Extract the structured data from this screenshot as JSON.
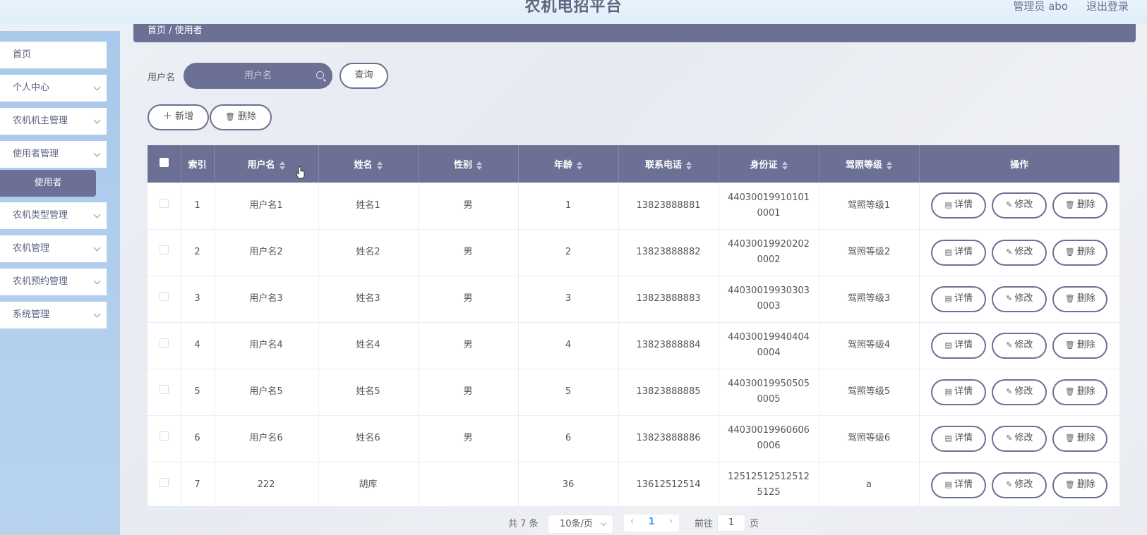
{
  "header": {
    "title": "农机电招平台",
    "user": "管理员 abo",
    "logout": "退出登录"
  },
  "sidebar": {
    "items": [
      {
        "label": "首页",
        "expandable": false
      },
      {
        "label": "个人中心",
        "expandable": true
      },
      {
        "label": "农机机主管理",
        "expandable": true
      },
      {
        "label": "使用者管理",
        "expandable": true
      },
      {
        "label": "农机类型管理",
        "expandable": true
      },
      {
        "label": "农机管理",
        "expandable": true
      },
      {
        "label": "农机预约管理",
        "expandable": true
      },
      {
        "label": "系统管理",
        "expandable": true
      }
    ],
    "active_sub": "使用者"
  },
  "breadcrumb": "首页 / 使用者",
  "search": {
    "label": "用户名",
    "placeholder": "用户名",
    "query_button": "查询"
  },
  "toolbar": {
    "add": "新增",
    "delete": "删除"
  },
  "table": {
    "columns": [
      "索引",
      "用户名",
      "姓名",
      "性别",
      "年龄",
      "联系电话",
      "身份证",
      "驾照等级",
      "操作"
    ],
    "rows": [
      {
        "index": "1",
        "username": "用户名1",
        "name": "姓名1",
        "gender": "男",
        "age": "1",
        "phone": "13823888881",
        "id_card": "440300199101010001",
        "license": "驾照等级1"
      },
      {
        "index": "2",
        "username": "用户名2",
        "name": "姓名2",
        "gender": "男",
        "age": "2",
        "phone": "13823888882",
        "id_card": "440300199202020002",
        "license": "驾照等级2"
      },
      {
        "index": "3",
        "username": "用户名3",
        "name": "姓名3",
        "gender": "男",
        "age": "3",
        "phone": "13823888883",
        "id_card": "440300199303030003",
        "license": "驾照等级3"
      },
      {
        "index": "4",
        "username": "用户名4",
        "name": "姓名4",
        "gender": "男",
        "age": "4",
        "phone": "13823888884",
        "id_card": "440300199404040004",
        "license": "驾照等级4"
      },
      {
        "index": "5",
        "username": "用户名5",
        "name": "姓名5",
        "gender": "男",
        "age": "5",
        "phone": "13823888885",
        "id_card": "440300199505050005",
        "license": "驾照等级5"
      },
      {
        "index": "6",
        "username": "用户名6",
        "name": "姓名6",
        "gender": "男",
        "age": "6",
        "phone": "13823888886",
        "id_card": "440300199606060006",
        "license": "驾照等级6"
      },
      {
        "index": "7",
        "username": "222",
        "name": "胡库",
        "gender": "",
        "age": "36",
        "phone": "13612512514",
        "id_card": "125125125125125125",
        "license": "a"
      }
    ],
    "row_actions": {
      "detail": "详情",
      "edit": "修改",
      "delete": "删除"
    }
  },
  "pagination": {
    "total": "共 7 条",
    "page_size": "10条/页",
    "current_page": "1",
    "goto_prefix": "前往",
    "goto_value": "1",
    "goto_suffix": "页"
  },
  "colors": {
    "primary": "#6b7094",
    "sidebar": "#a9c9ea",
    "topbar": "#e3f0f9"
  }
}
